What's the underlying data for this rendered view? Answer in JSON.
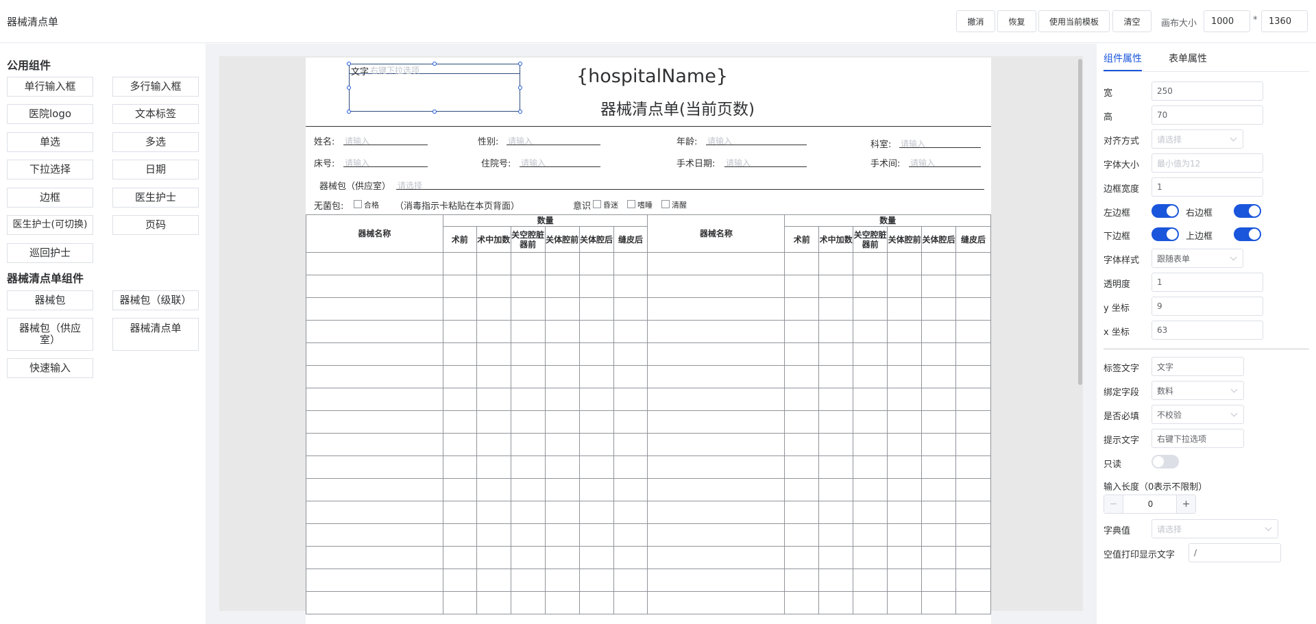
{
  "app": {
    "title": "器械清点单"
  },
  "toolbar": {
    "undo": "撤消",
    "redo": "恢复",
    "use_template": "使用当前模板",
    "clear": "清空",
    "canvas_size_label": "画布大小",
    "canvas_width": "1000",
    "separator": "*",
    "canvas_height": "1360"
  },
  "left": {
    "common_title": "公用组件",
    "common_items": [
      "单行输入框",
      "多行输入框",
      "医院logo",
      "文本标签",
      "单选",
      "多选",
      "下拉选择",
      "日期",
      "边框",
      "医生护士",
      "医生护士(可切换)",
      "页码",
      "巡回护士"
    ],
    "checklist_title": "器械清点单组件",
    "checklist_items": [
      "器械包",
      "器械包（级联）",
      "器械包（供应室）",
      "器械清点单",
      "快速输入"
    ]
  },
  "doc": {
    "selected_label": "文字",
    "selected_placeholder": "右键下拉选项",
    "hospital_name": "{hospitalName}",
    "doc_title": "器械清点单(当前页数)",
    "row1": [
      {
        "label": "姓名:",
        "placeholder": "请输入"
      },
      {
        "label": "性别:",
        "placeholder": "请输入"
      },
      {
        "label": "年龄:",
        "placeholder": "请输入"
      },
      {
        "label": "科室:",
        "placeholder": "请输入"
      }
    ],
    "row2": [
      {
        "label": "床号:",
        "placeholder": "请输入"
      },
      {
        "label": "住院号:",
        "placeholder": "请输入"
      },
      {
        "label": "手术日期:",
        "placeholder": "请输入"
      },
      {
        "label": "手术间:",
        "placeholder": "请输入"
      }
    ],
    "kit_label": "器械包（供应室）",
    "kit_placeholder": "请选择",
    "sterile_label": "无菌包:",
    "sterile_option": "合格",
    "sterile_note": "（消毒指示卡粘贴在本页背面）",
    "consciousness_label": "意识",
    "consciousness_options": [
      "昏迷",
      "嗜睡",
      "清醒"
    ],
    "table": {
      "name_header": "器械名称",
      "qty_header": "数量",
      "sub_headers": [
        "术前",
        "术中加数",
        "关空腔脏器前",
        "关体腔前",
        "关体腔后",
        "缝皮后"
      ],
      "rows": 16
    }
  },
  "right": {
    "tabs": [
      "组件属性",
      "表单属性"
    ],
    "width_label": "宽",
    "width_value": "250",
    "height_label": "高",
    "height_value": "70",
    "align_label": "对齐方式",
    "align_placeholder": "请选择",
    "fontsize_label": "字体大小",
    "fontsize_placeholder": "最小值为12",
    "border_width_label": "边框宽度",
    "border_width_value": "1",
    "left_border_label": "左边框",
    "right_border_label": "右边框",
    "bottom_border_label": "下边框",
    "top_border_label": "上边框",
    "font_style_label": "字体样式",
    "font_style_value": "跟随表单",
    "opacity_label": "透明度",
    "opacity_value": "1",
    "y_label": "y 坐标",
    "y_value": "9",
    "x_label": "x 坐标",
    "x_value": "63",
    "tag_text_label": "标签文字",
    "tag_text_value": "文字",
    "bind_field_label": "绑定字段",
    "bind_field_value": "数料",
    "required_label": "是否必填",
    "required_value": "不校验",
    "hint_label": "提示文字",
    "hint_value": "右键下拉选项",
    "readonly_label": "只读",
    "input_len_label": "输入长度（0表示不限制）",
    "input_len_value": "0",
    "minus": "−",
    "plus": "+",
    "dict_label": "字典值",
    "dict_placeholder": "请选择",
    "empty_print_label": "空值打印显示文字",
    "empty_print_value": "/"
  }
}
